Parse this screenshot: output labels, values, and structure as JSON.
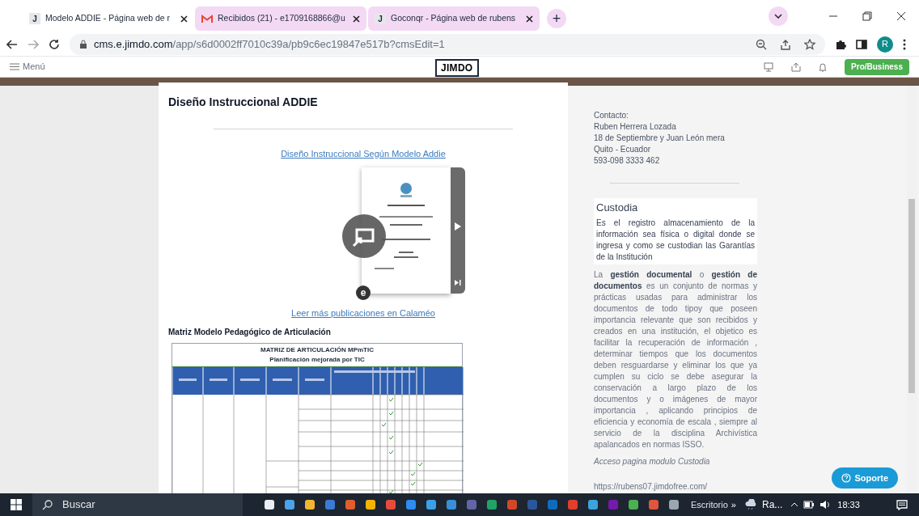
{
  "browser": {
    "tabs": [
      {
        "title": "Modelo ADDIE - Página web de r",
        "kind": "letter",
        "favicon_text": "J",
        "selected": true
      },
      {
        "title": "Recibidos (21) - e1709168866@u",
        "kind": "mail",
        "selected": false
      },
      {
        "title": "Goconqr - Página web de rubens",
        "kind": "letter",
        "favicon_text": "J",
        "selected": false
      }
    ],
    "new_tab": "+",
    "url_host": "cms.e.jimdo.com",
    "url_path": "/app/s6d0002ff7010c39a/pb9c6ec19847e517b?cmsEdit=1",
    "profile": "R"
  },
  "editor": {
    "menu": "Menú",
    "logo": "JIMDO",
    "plan_button": "Pro/Business"
  },
  "content": {
    "heading": "Diseño Instruccional ADDIE",
    "doc_link": "Diseño Instruccional Según Modelo Addie",
    "viewer_badge": "e",
    "more_link": "Leer más publicaciones en Calaméo",
    "matrix_heading": "Matriz Modelo Pedagógico de Articulación",
    "matrix": {
      "title": "MATRIZ DE ARTICULACIÓN MPmTIC",
      "subtitle": "Planificación mejorada por TIC"
    }
  },
  "sidebar": {
    "contact": [
      "Contacto:",
      "Ruben Herrera Lozada",
      "18 de Septiembre y Juan León mera",
      "Quito - Ecuador",
      "593-098 3333 462"
    ],
    "custodia_title": "Custodia",
    "custodia_text": "Es el registro almacenamiento de la información  sea física o digital donde se ingresa y como se custodian las Garantías de la Institución",
    "paragraph": "La **gestión documental** o **gestión de documentos** es un conjunto de normas y prácticas usadas para administrar los documentos de todo tipoy que poseen importancia relevante  que son recibidos y creados en una institución, el objetico es facilitar la recuperación de información , determinar tiempos que los documentos deben resguardarse y eliminar los que ya cumplen su ciclo se debe asegurar la conservación a largo plazo de los documentos y o imágenes de mayor importancia , aplicando principios de eficiencia y economía de escala , siempre al servicio de la disciplina Archivística apalancados en normas ISSO.",
    "access": "Acceso pagina modulo Custodia",
    "site_url": "https://rubens07.jimdofree.com/"
  },
  "support_button": "Soporte",
  "taskbar": {
    "search": "Buscar",
    "desktop": "Escritorio",
    "chevron": "»",
    "weather": "Ra...",
    "time": "18:33"
  }
}
